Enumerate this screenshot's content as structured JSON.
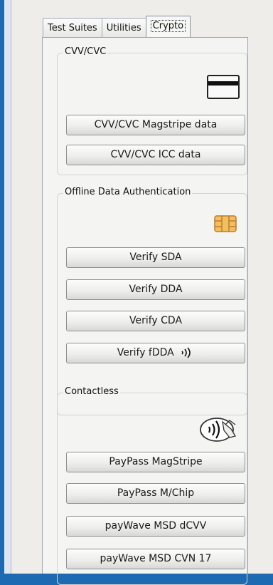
{
  "tabs": [
    {
      "label": "Test Suites"
    },
    {
      "label": "Utilities"
    },
    {
      "label": "Crypto"
    }
  ],
  "groups": {
    "cvv": {
      "title": "CVV/CVC",
      "icon": "magstripe-card-icon",
      "buttons": [
        "CVV/CVC Magstripe data",
        "CVV/CVC ICC data"
      ]
    },
    "oda": {
      "title": "Offline Data Authentication",
      "icon": "emv-chip-icon",
      "buttons": [
        "Verify SDA",
        "Verify DDA",
        "Verify CDA",
        "Verify fDDA"
      ],
      "fdda_suffix_icon": "contactless-waves-icon"
    },
    "contactless": {
      "title": "Contactless",
      "icon": "contactless-card-icon",
      "buttons": [
        "PayPass MagStripe",
        "PayPass M/Chip",
        "payWave MSD dCVV",
        "payWave MSD CVN 17"
      ]
    }
  },
  "colors": {
    "background": "#1d6ab3",
    "panel": "#f4f4f2",
    "chip_fill": "#f0c060",
    "chip_stroke": "#c07a2a"
  }
}
